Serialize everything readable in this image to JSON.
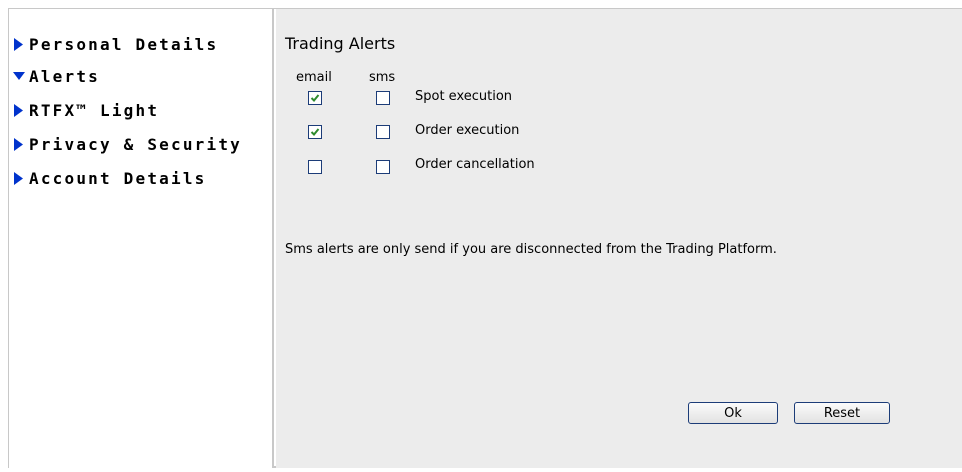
{
  "sidebar": {
    "items": [
      {
        "label": "Personal Details",
        "icon": "triangle-right-icon",
        "expanded": false
      },
      {
        "label": "Alerts",
        "icon": "triangle-down-icon",
        "expanded": true
      },
      {
        "label": "RTFX™ Light",
        "icon": "triangle-right-icon",
        "expanded": false
      },
      {
        "label": "Privacy & Security",
        "icon": "triangle-right-icon",
        "expanded": false
      },
      {
        "label": "Account Details",
        "icon": "triangle-right-icon",
        "expanded": false
      }
    ]
  },
  "main": {
    "title": "Trading Alerts",
    "columns": {
      "email": "email",
      "sms": "sms"
    },
    "rows": [
      {
        "label": "Spot execution",
        "email": true,
        "sms": false
      },
      {
        "label": "Order execution",
        "email": true,
        "sms": false
      },
      {
        "label": "Order cancellation",
        "email": false,
        "sms": false
      }
    ],
    "note": "Sms alerts are only send if you are disconnected from the Trading Platform.",
    "buttons": {
      "ok": "Ok",
      "reset": "Reset"
    }
  },
  "colors": {
    "accent": "#1c3c78",
    "arrow": "#0033cc",
    "check": "#2e8b2e",
    "panel": "#ececec"
  }
}
